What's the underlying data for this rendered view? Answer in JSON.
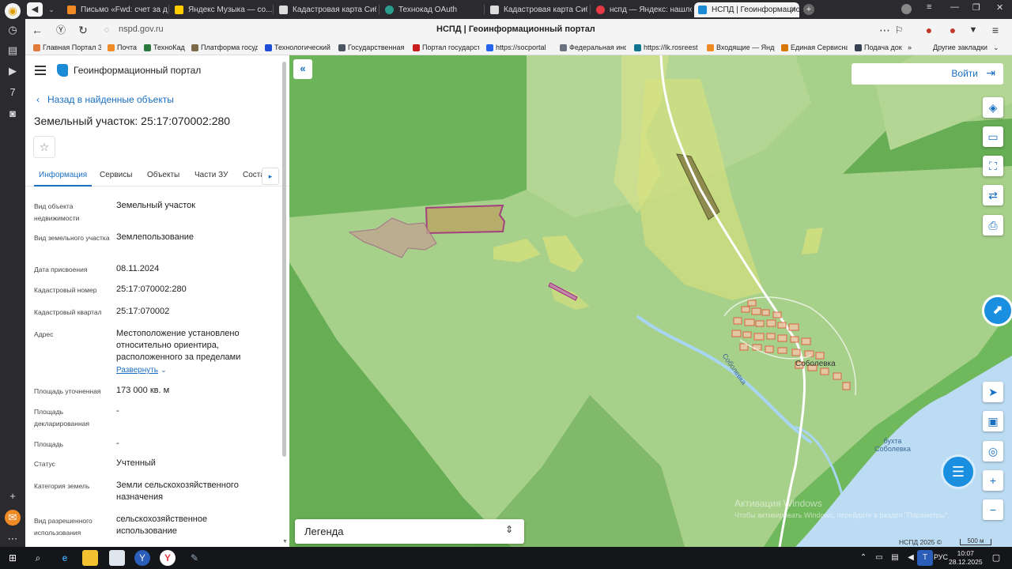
{
  "browser": {
    "tabs": [
      {
        "title": "Письмо «Fwd: счет за две",
        "color": "#f08a24"
      },
      {
        "title": "Яндекс Музыка — со...",
        "color": "#ffcc00"
      },
      {
        "title": "Кадастровая карта Сибир",
        "color": "#dddddd"
      },
      {
        "title": "Технокад OAuth",
        "color": "#2a9d8f"
      },
      {
        "title": "Кадастровая карта Сибир",
        "color": "#dddddd"
      },
      {
        "title": "нспд — Яндекс: нашлось",
        "color": "#e63946"
      },
      {
        "title": "НСПД | Геоинформацио",
        "color": "#1b8bd8"
      }
    ],
    "url": "nspd.gov.ru",
    "page_title": "НСПД | Геоинформационный портал",
    "bookmarks": [
      {
        "label": "Главная Портал З",
        "color": "#e07b39"
      },
      {
        "label": "Почта",
        "color": "#f08a24"
      },
      {
        "label": "ТехноКад",
        "color": "#2b7a3d"
      },
      {
        "label": "Платформа госуд",
        "color": "#7e6b4a"
      },
      {
        "label": "Технологический",
        "color": "#1d4ed8"
      },
      {
        "label": "Государственная",
        "color": "#4b5563"
      },
      {
        "label": "Портал государст",
        "color": "#c81e1e"
      },
      {
        "label": "https://socportal",
        "color": "#2563eb"
      },
      {
        "label": "Федеральная инф",
        "color": "#6b7280"
      },
      {
        "label": "https://lk.rosreest",
        "color": "#0e7490"
      },
      {
        "label": "Входящие — Янде",
        "color": "#f08a24"
      },
      {
        "label": "Единая Сервисна",
        "color": "#d97706"
      },
      {
        "label": "Подача док",
        "color": "#374151"
      }
    ],
    "bookmarks_more": "»",
    "other_bookmarks": "Другие закладки"
  },
  "panel": {
    "portal_name": "Геоинформационный портал",
    "back_link": "Назад в найденные объекты",
    "object_title": "Земельный участок: 25:17:070002:280",
    "tabs": [
      "Информация",
      "Сервисы",
      "Объекты",
      "Части ЗУ",
      "Соста"
    ],
    "fields": [
      {
        "label": "Вид объекта недвижимости",
        "value": "Земельный участок"
      },
      {
        "label": "Вид земельного участка",
        "value": "Землепользование"
      },
      {
        "label": "Дата присвоения",
        "value": "08.11.2024"
      },
      {
        "label": "Кадастровый номер",
        "value": "25:17:070002:280"
      },
      {
        "label": "Кадастровый квартал",
        "value": "25:17:070002"
      },
      {
        "label": "Адрес",
        "value": "Местоположение установлено относительно ориентира, расположенного за пределами"
      },
      {
        "label": "Площадь уточненная",
        "value": "173 000 кв. м"
      },
      {
        "label": "Площадь декларированная",
        "value": "-"
      },
      {
        "label": "Площадь",
        "value": "-"
      },
      {
        "label": "Статус",
        "value": "Учтенный"
      },
      {
        "label": "Категория земель",
        "value": "Земли сельскохозяйственного назначения"
      },
      {
        "label": "Вид разрешенного использования",
        "value": "сельскохозяйственное использование"
      }
    ],
    "expand_link": "Развернуть"
  },
  "map": {
    "login": "Войти",
    "legend": "Легенда",
    "labels": {
      "village": "Соболевка",
      "river": "Соболевка",
      "bay": "бухта Соболевка"
    },
    "copyright": "НСПД 2025 ©",
    "scale": "500 м",
    "watermark_title": "Активация Windows",
    "watermark_text": "Чтобы активировать Windows, перейдите в раздел \"Параметры\"."
  },
  "taskbar": {
    "lang": "РУС",
    "time": "10:07",
    "date": "28.12.2025"
  }
}
